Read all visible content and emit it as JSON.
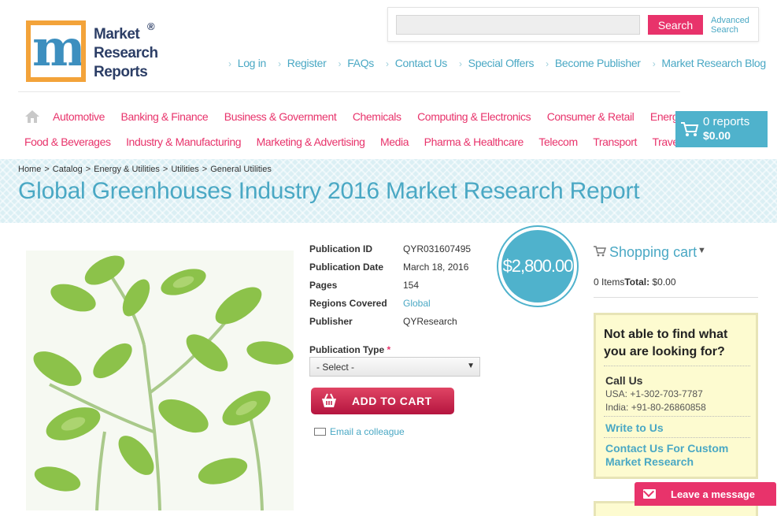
{
  "logo": {
    "line1": "Market",
    "line2": "Research",
    "line3": "Reports",
    "reg": "®"
  },
  "search": {
    "placeholder": "",
    "button": "Search",
    "advanced": "Advanced Search"
  },
  "top_links": [
    "Log in",
    "Register",
    "FAQs",
    "Contact Us",
    "Special Offers",
    "Become Publisher",
    "Market Research Blog"
  ],
  "nav": {
    "row1": [
      "Automotive",
      "Banking & Finance",
      "Business & Government",
      "Chemicals",
      "Computing & Electronics",
      "Consumer & Retail",
      "Energy & Utilities"
    ],
    "row2": [
      "Food & Beverages",
      "Industry & Manufacturing",
      "Marketing & Advertising",
      "Media",
      "Pharma & Healthcare",
      "Telecom",
      "Transport",
      "Travel & Leisure"
    ]
  },
  "cart": {
    "count": "0 reports",
    "total": "$0.00"
  },
  "breadcrumb": [
    "Home",
    "Catalog",
    "Energy & Utilities",
    "Utilities",
    "General Utilities"
  ],
  "page_title": "Global Greenhouses Industry 2016 Market Research Report",
  "details": {
    "pub_id_label": "Publication ID",
    "pub_id": "QYR031607495",
    "pub_date_label": "Publication Date",
    "pub_date": "March 18, 2016",
    "pages_label": "Pages",
    "pages": "154",
    "regions_label": "Regions Covered",
    "regions": "Global",
    "publisher_label": "Publisher",
    "publisher": "QYResearch"
  },
  "price": "$2,800.00",
  "pub_type": {
    "label": "Publication Type",
    "required": "*",
    "selected": "- Select -"
  },
  "add_to_cart": "ADD TO CART",
  "email_colleague": "Email a colleague",
  "shopping_cart": {
    "title": "Shopping cart",
    "items": "0 Items",
    "total_label": "Total:",
    "total": "$0.00"
  },
  "help": {
    "title": "Not able to find what you are looking for?",
    "call_title": "Call Us",
    "usa": "USA: +1-302-703-7787",
    "india": "India: +91-80-26860858",
    "write": "Write to Us",
    "custom": "Contact Us For Custom Market Research"
  },
  "leave_message": "Leave a message",
  "colors": {
    "accent_pink": "#e8336b",
    "accent_blue": "#4aa8c4",
    "cart_blue": "#4fb2cc"
  }
}
